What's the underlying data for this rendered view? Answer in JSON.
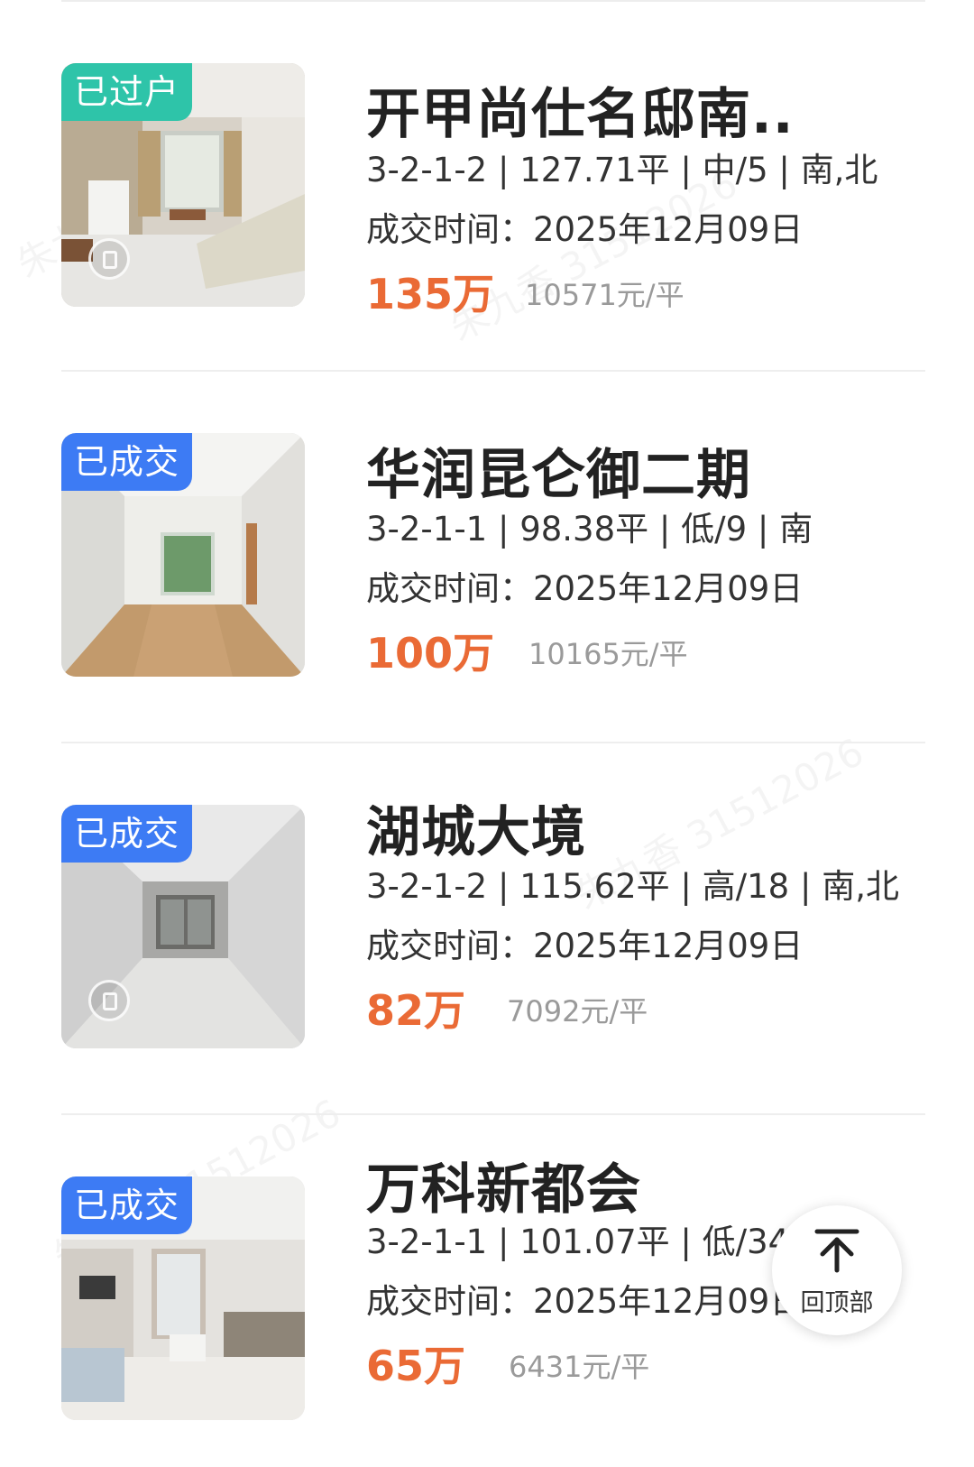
{
  "listings": [
    {
      "badge": "已过户",
      "badge_color": "#2ec4a9",
      "name": "开甲尚仕名邸南..",
      "meta": "3-2-1-2 | 127.71平 | 中/5 | 南,北",
      "deal_label": "成交时间：",
      "deal_date": "2025年12月09日",
      "price": "135万",
      "unit_price": "10571元/平",
      "photo_icon": "vr-tour-icon"
    },
    {
      "badge": "已成交",
      "badge_color": "#3d7bf4",
      "name": "华润昆仑御二期",
      "meta": "3-2-1-1 | 98.38平 | 低/9 | 南",
      "deal_label": "成交时间：",
      "deal_date": "2025年12月09日",
      "price": "100万",
      "unit_price": "10165元/平",
      "photo_icon": ""
    },
    {
      "badge": "已成交",
      "badge_color": "#3d7bf4",
      "name": "湖城大境",
      "meta": "3-2-1-2 | 115.62平 | 高/18 | 南,北",
      "deal_label": "成交时间：",
      "deal_date": "2025年12月09日",
      "price": "82万",
      "unit_price": "7092元/平",
      "photo_icon": "vr-tour-icon"
    },
    {
      "badge": "已成交",
      "badge_color": "#3d7bf4",
      "name": "万科新都会",
      "meta": "3-2-1-1 | 101.07平 | 低/34",
      "deal_label": "成交时间：",
      "deal_date": "2025年12月09日",
      "price": "65万",
      "unit_price": "6431元/平",
      "photo_icon": ""
    }
  ],
  "back_to_top": {
    "label": "回顶部",
    "icon": "arrow-up-to-top-icon"
  },
  "watermark": "朱九香 31512026"
}
